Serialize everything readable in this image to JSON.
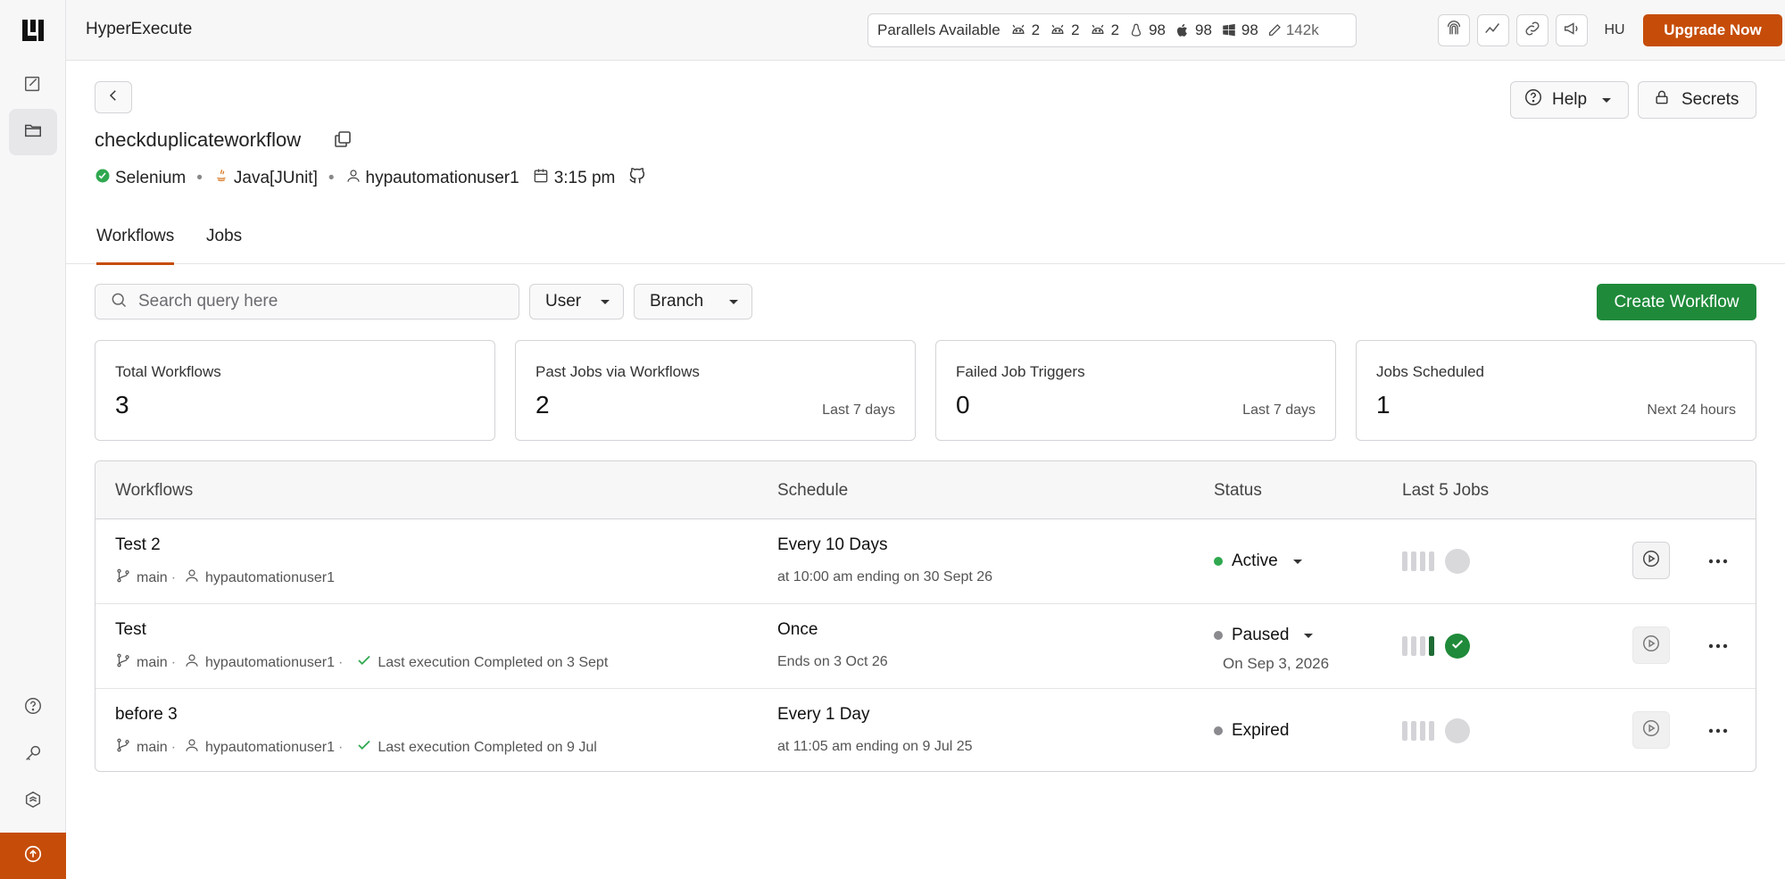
{
  "app": {
    "title": "HyperExecute"
  },
  "parallels": {
    "label": "Parallels Available",
    "items": [
      {
        "icon": "android-icon",
        "value": "2"
      },
      {
        "icon": "android-icon",
        "value": "2"
      },
      {
        "icon": "android-icon",
        "value": "2"
      },
      {
        "icon": "linux-icon",
        "value": "98"
      },
      {
        "icon": "apple-icon",
        "value": "98"
      },
      {
        "icon": "windows-icon",
        "value": "98"
      },
      {
        "icon": "pen-icon",
        "value": "142k"
      }
    ]
  },
  "user": {
    "initials": "HU"
  },
  "header": {
    "upgrade_label": "Upgrade Now",
    "help_label": "Help",
    "secrets_label": "Secrets",
    "title": "checkduplicateworkflow",
    "framework": "Selenium",
    "language": "Java[JUnit]",
    "owner": "hypautomationuser1",
    "time": "3:15 pm"
  },
  "tabs": [
    {
      "label": "Workflows"
    },
    {
      "label": "Jobs"
    }
  ],
  "toolbar": {
    "search_placeholder": "Search query here",
    "user_filter": "User",
    "branch_filter": "Branch",
    "create_label": "Create Workflow"
  },
  "stats": [
    {
      "label": "Total Workflows",
      "value": "3",
      "sub": ""
    },
    {
      "label": "Past Jobs via Workflows",
      "value": "2",
      "sub": "Last 7 days"
    },
    {
      "label": "Failed Job Triggers",
      "value": "0",
      "sub": "Last 7 days"
    },
    {
      "label": "Jobs Scheduled",
      "value": "1",
      "sub": "Next 24 hours"
    }
  ],
  "table": {
    "columns": [
      "Workflows",
      "Schedule",
      "Status",
      "Last 5 Jobs"
    ],
    "rows": [
      {
        "name": "Test 2",
        "branch": "main",
        "user": "hypautomationuser1",
        "last_exec": "",
        "schedule": "Every 10 Days",
        "schedule_sub": "at 10:00 am ending on 30 Sept 26",
        "status": "Active",
        "status_color": "#2fa84f",
        "status_sub": "",
        "jobs": "none"
      },
      {
        "name": "Test",
        "branch": "main",
        "user": "hypautomationuser1",
        "last_exec": "Last execution Completed on 3 Sept",
        "schedule": "Once",
        "schedule_sub": "Ends on 3 Oct 26",
        "status": "Paused",
        "status_color": "#8a8a8f",
        "status_sub": "On Sep 3, 2026",
        "jobs": "success"
      },
      {
        "name": "before 3",
        "branch": "main",
        "user": "hypautomationuser1",
        "last_exec": "Last execution Completed on 9 Jul",
        "schedule": "Every 1 Day",
        "schedule_sub": "at 11:05 am ending on 9 Jul 25",
        "status": "Expired",
        "status_color": "#8a8a8f",
        "status_sub": "",
        "jobs": "none"
      }
    ]
  },
  "colors": {
    "accent": "#c64d09",
    "primary": "#1f8a3a",
    "active": "#2fa84f"
  }
}
